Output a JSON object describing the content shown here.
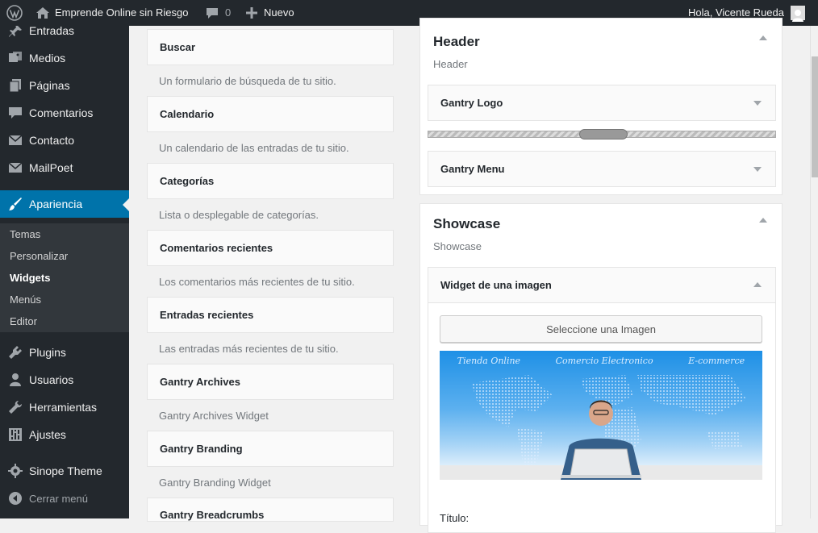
{
  "adminbar": {
    "site_name": "Emprende Online sin Riesgo",
    "comments_count": "0",
    "new_label": "Nuevo",
    "greeting": "Hola, Vicente Rueda"
  },
  "sidebar": {
    "items": [
      {
        "label": "Entradas",
        "icon": "pin-icon"
      },
      {
        "label": "Medios",
        "icon": "media-icon"
      },
      {
        "label": "Páginas",
        "icon": "pages-icon"
      },
      {
        "label": "Comentarios",
        "icon": "comment-icon"
      },
      {
        "label": "Contacto",
        "icon": "mail-icon"
      },
      {
        "label": "MailPoet",
        "icon": "mail-icon"
      },
      {
        "label": "Apariencia",
        "icon": "brush-icon"
      },
      {
        "label": "Plugins",
        "icon": "plugin-icon"
      },
      {
        "label": "Usuarios",
        "icon": "user-icon"
      },
      {
        "label": "Herramientas",
        "icon": "wrench-icon"
      },
      {
        "label": "Ajustes",
        "icon": "sliders-icon"
      },
      {
        "label": "Sinope Theme",
        "icon": "gear-icon"
      },
      {
        "label": "Cerrar menú",
        "icon": "collapse-icon"
      }
    ],
    "submenu": [
      "Temas",
      "Personalizar",
      "Widgets",
      "Menús",
      "Editor"
    ]
  },
  "available_widgets": [
    {
      "title": "Buscar",
      "desc": "Un formulario de búsqueda de tu sitio."
    },
    {
      "title": "Calendario",
      "desc": "Un calendario de las entradas de tu sitio."
    },
    {
      "title": "Categorías",
      "desc": "Lista o desplegable de categorías."
    },
    {
      "title": "Comentarios recientes",
      "desc": "Los comentarios más recientes de tu sitio."
    },
    {
      "title": "Entradas recientes",
      "desc": "Las entradas más recientes de tu sitio."
    },
    {
      "title": "Gantry Archives",
      "desc": "Gantry Archives Widget"
    },
    {
      "title": "Gantry Branding",
      "desc": "Gantry Branding Widget"
    },
    {
      "title": "Gantry Breadcrumbs",
      "desc": ""
    }
  ],
  "header_sidebar": {
    "title": "Header",
    "subtitle": "Header",
    "widgets": [
      "Gantry Logo",
      "Gantry Menu"
    ]
  },
  "showcase_sidebar": {
    "title": "Showcase",
    "subtitle": "Showcase",
    "widget_title": "Widget de una imagen",
    "select_button": "Seleccione una Imagen",
    "banner_words": [
      "Tienda Online",
      "Comercio Electronico",
      "E-commerce"
    ],
    "partial_label": "Título:"
  },
  "colors": {
    "adminbar_bg": "#23282d",
    "active_menu": "#0073aa",
    "page_bg": "#f1f1f1"
  }
}
